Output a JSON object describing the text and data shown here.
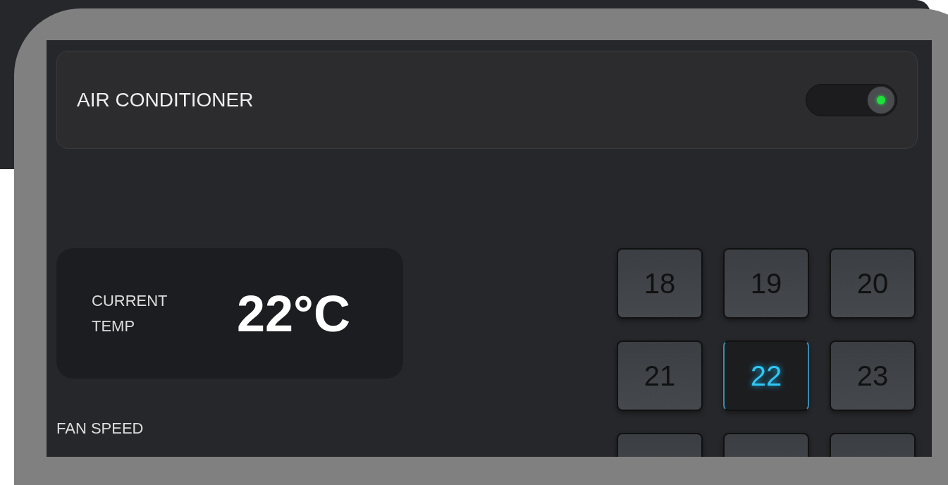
{
  "header": {
    "title": "AIR CONDITIONER",
    "power_on": true
  },
  "current_temp": {
    "label": "CURRENT TEMP",
    "value": "22°C"
  },
  "fan_speed": {
    "label": "FAN SPEED"
  },
  "tiles": [
    {
      "label": "18",
      "selected": false
    },
    {
      "label": "19",
      "selected": false
    },
    {
      "label": "20",
      "selected": false
    },
    {
      "label": "21",
      "selected": false
    },
    {
      "label": "22",
      "selected": true
    },
    {
      "label": "23",
      "selected": false
    },
    {
      "selected": false
    },
    {
      "selected": false
    },
    {
      "selected": false
    }
  ]
}
